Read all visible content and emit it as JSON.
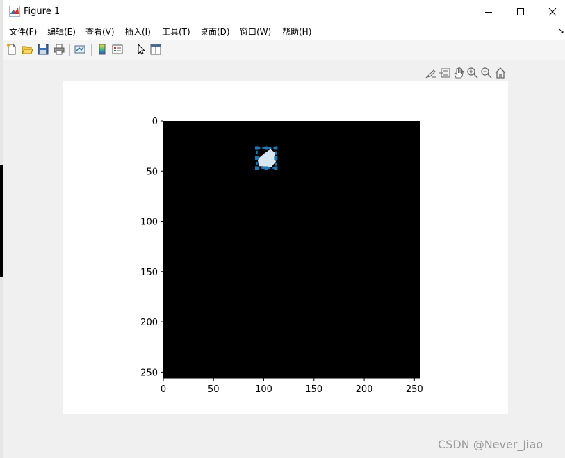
{
  "window": {
    "title": "Figure 1"
  },
  "menu": {
    "items": [
      "文件(F)",
      "编辑(E)",
      "查看(V)",
      "插入(I)",
      "工具(T)",
      "桌面(D)",
      "窗口(W)",
      "帮助(H)"
    ]
  },
  "toolbar": {
    "icons": [
      "new-figure-icon",
      "open-file-icon",
      "save-icon",
      "print-icon",
      "link-plot-icon",
      "colorbar-icon",
      "legend-icon",
      "edit-plot-arrow-icon",
      "property-inspector-icon"
    ]
  },
  "axes_toolbar": {
    "icons": [
      "brush-icon",
      "data-tips-icon",
      "pan-hand-icon",
      "zoom-in-icon",
      "zoom-out-icon",
      "restore-home-icon"
    ]
  },
  "chart_data": {
    "type": "heatmap",
    "title": "",
    "xlabel": "",
    "ylabel": "",
    "xlim": [
      0,
      256
    ],
    "ylim": [
      256,
      0
    ],
    "xticks": [
      0,
      50,
      100,
      150,
      200,
      250
    ],
    "yticks": [
      0,
      50,
      100,
      150,
      200,
      250
    ],
    "image": "binary mask, black background",
    "background_color": "#000000",
    "blob": {
      "color": "#d6e6f3",
      "center": [
        103,
        37
      ],
      "size": [
        18,
        18
      ]
    },
    "bounding_box": {
      "x": [
        93,
        112
      ],
      "y": [
        27,
        47
      ],
      "color": "#1f77b4",
      "style": "dashed"
    }
  },
  "watermark": {
    "text": "CSDN @Never_Jiao"
  }
}
